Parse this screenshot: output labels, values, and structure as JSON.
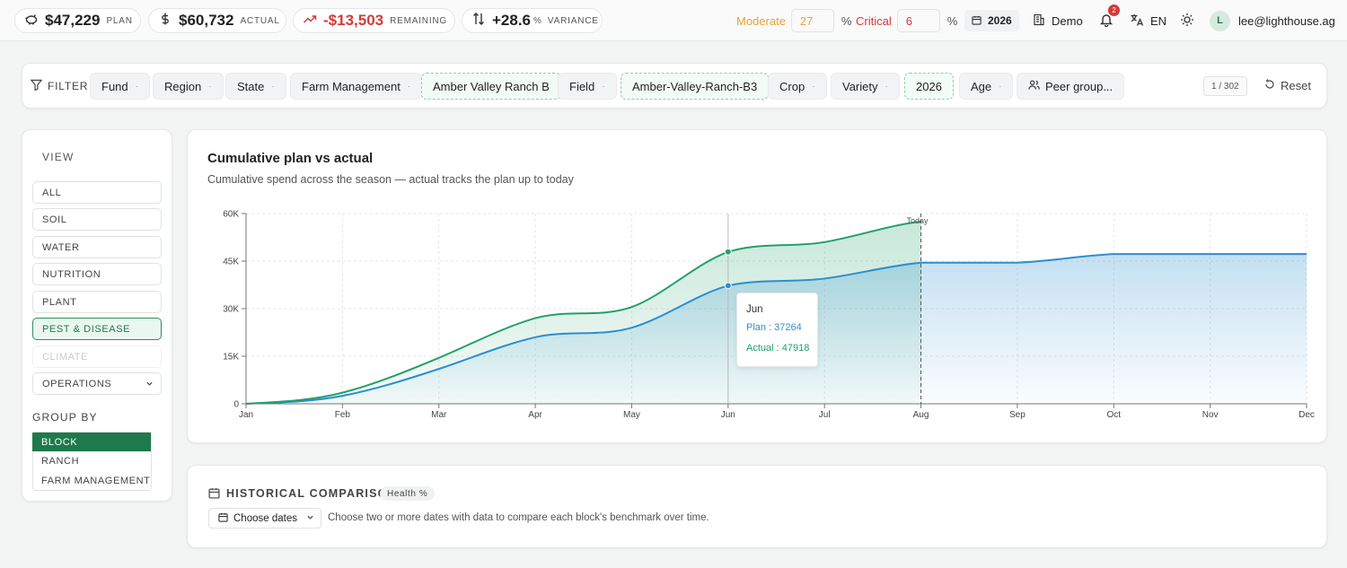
{
  "kpis": [
    {
      "value": "$47,229",
      "label": "PLAN",
      "icon": "piggy-bank-icon"
    },
    {
      "value": "$60,732",
      "label": "ACTUAL",
      "icon": "dollar-icon"
    },
    {
      "value": "-$13,503",
      "label": "REMAINING",
      "icon": "trend-up-icon",
      "color": "#d33a3a"
    },
    {
      "value": "+28.6",
      "unit": "%",
      "label": "VARIANCE",
      "icon": "arrows-updown-icon"
    }
  ],
  "thresholds": {
    "moderate_label": "Moderate",
    "moderate_value": "27",
    "critical_label": "Critical",
    "critical_value": "6",
    "unit": "%",
    "moderate_color": "#e8a23a",
    "critical_color": "#d33a3a"
  },
  "header": {
    "year": "2026",
    "org": "Demo",
    "notifications": "2",
    "language": "EN",
    "user_initial": "L",
    "user_email": "lee@lighthouse.ag"
  },
  "filter": {
    "label": "FILTER",
    "chips": [
      "Fund",
      "Region",
      "State",
      "Farm Management",
      "Amber Valley Ranch B",
      "Field",
      "Amber-Valley-Ranch-B3",
      "Crop",
      "Variety",
      "2026",
      "Age",
      "Peer group..."
    ],
    "count": "1 / 302",
    "reset": "Reset"
  },
  "view": {
    "title": "VIEW",
    "items": [
      "ALL",
      "SOIL",
      "WATER",
      "NUTRITION",
      "PLANT",
      "PEST & DISEASE",
      "CLIMATE",
      "OPERATIONS"
    ],
    "active": "PEST & DISEASE",
    "disabled": "CLIMATE"
  },
  "group_by": {
    "title": "GROUP BY",
    "items": [
      "BLOCK",
      "RANCH",
      "FARM MANAGEMENT"
    ],
    "active": "BLOCK"
  },
  "chart_title": "Cumulative plan vs actual",
  "chart_subtitle": "Cumulative spend across the season — actual tracks the plan up to today",
  "chart_data": {
    "type": "area",
    "categories": [
      "Jan",
      "Feb",
      "Mar",
      "Apr",
      "May",
      "Jun",
      "Jul",
      "Aug",
      "Sep",
      "Oct",
      "Nov",
      "Dec"
    ],
    "series": [
      {
        "name": "Plan",
        "color": "#2b8fd0",
        "values": [
          0,
          2500,
          11000,
          21000,
          24000,
          37264,
          39500,
          44500,
          44500,
          47229,
          47229,
          47229
        ]
      },
      {
        "name": "Actual",
        "color": "#22a06b",
        "values": [
          0,
          3500,
          14500,
          27000,
          30500,
          47918,
          51000,
          57500
        ]
      }
    ],
    "y_ticks": [
      "0",
      "15K",
      "30K",
      "45K",
      "60K"
    ],
    "ylim": [
      0,
      60000
    ],
    "today_label": "Today",
    "today_month": "Aug",
    "tooltip": {
      "month": "Jun",
      "plan": "Plan : 37264",
      "actual": "Actual : 47918"
    },
    "grid": true
  },
  "historical": {
    "title": "HISTORICAL COMPARISON",
    "badge": "Health %",
    "dates_button": "Choose dates",
    "hint": "Choose two or more dates with data to compare each block's benchmark over time."
  }
}
